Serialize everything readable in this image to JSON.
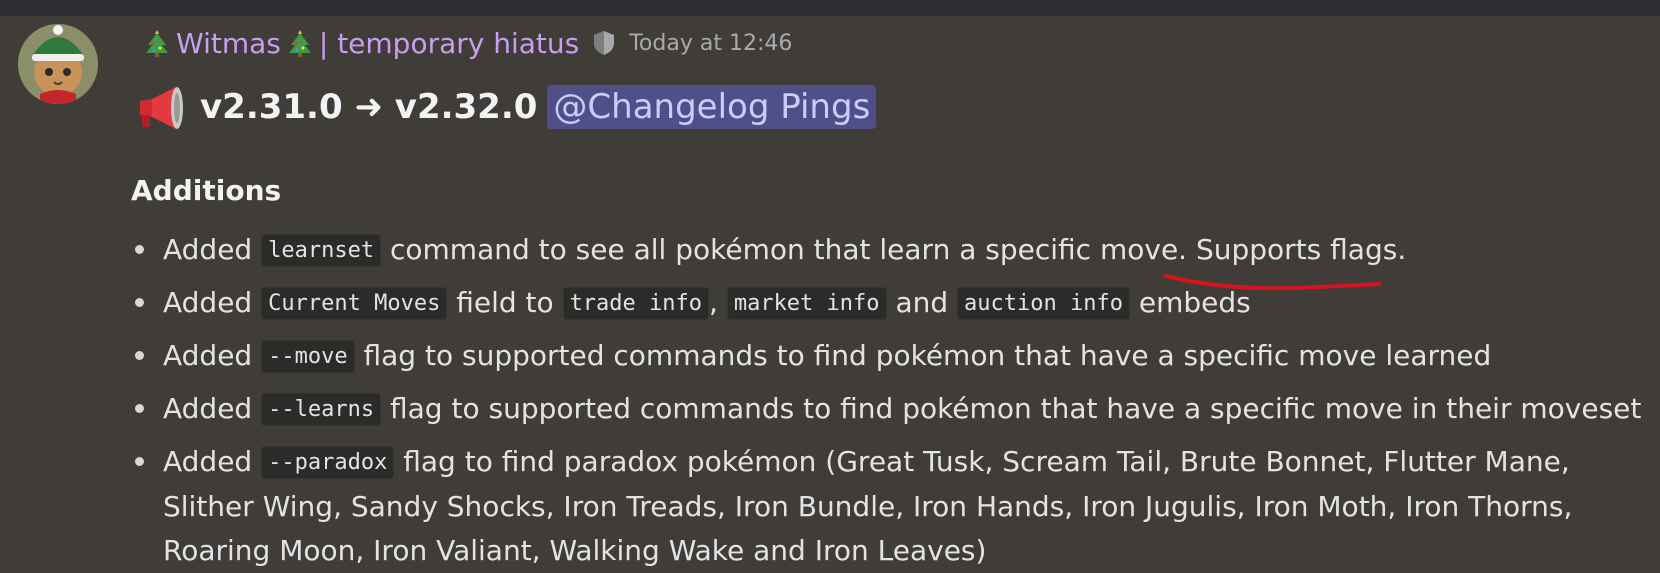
{
  "message": {
    "author": {
      "emoji_left": "🎄",
      "name": "Witmas",
      "emoji_right": "🎄",
      "status": "| temporary hiatus",
      "role_icon": "shield-icon",
      "name_color": "#c79ef0"
    },
    "timestamp": "Today at 12:46",
    "title": {
      "icon": "megaphone-icon",
      "text": "v2.31.0 ➜ v2.32.0",
      "mention": "@Changelog Pings"
    },
    "section": "Additions",
    "items": [
      {
        "p1": "Added",
        "c1": "learnset",
        "p2": "command to see all pokémon that learn a specific move.",
        "p3": "Supports flags."
      },
      {
        "p1": "Added",
        "c1": "Current Moves",
        "p2": "field to",
        "c2": "trade info",
        "p3": ",",
        "c3": "market info",
        "p4": "and",
        "c4": "auction info",
        "p5": "embeds"
      },
      {
        "p1": "Added",
        "c1": "--move",
        "p2": "flag to supported commands to find pokémon that have a specific move learned"
      },
      {
        "p1": "Added",
        "c1": "--learns",
        "p2": "flag to supported commands to find pokémon that have a specific move in their moveset"
      },
      {
        "p1": "Added",
        "c1": "--paradox",
        "p2": "flag to find paradox pokémon (Great Tusk, Scream Tail, Brute Bonnet, Flutter Mane, Slither Wing, Sandy Shocks, Iron Treads, Iron Bundle, Iron Hands, Iron Jugulis, Iron Moth, Iron Thorns, Roaring Moon, Iron Valiant, Walking Wake and Iron Leaves)"
      }
    ],
    "colors": {
      "background": "#403c37",
      "mention_bg": "#4f4f8a",
      "mention_text": "#c9cdfb",
      "annotation": "#d4141e"
    }
  }
}
